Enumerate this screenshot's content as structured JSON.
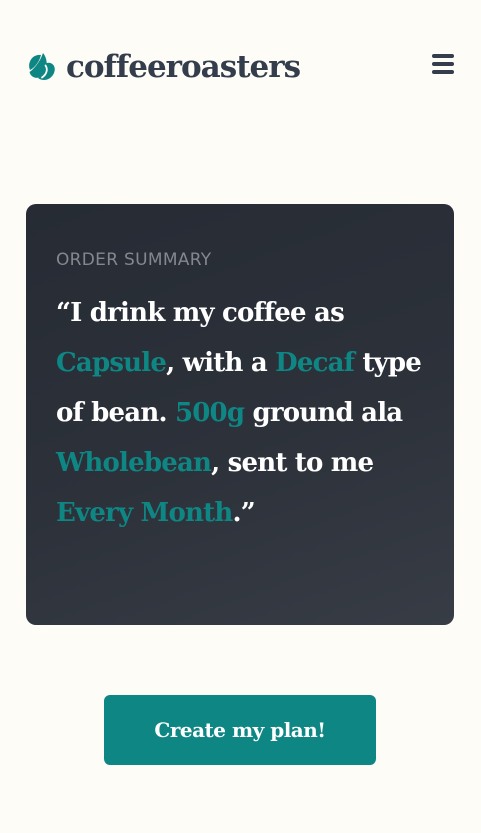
{
  "header": {
    "logo_text": "coffeeroasters",
    "logo_icon": "coffee-bean-icon",
    "menu_icon": "hamburger-menu-icon"
  },
  "summary": {
    "heading": "ORDER SUMMARY",
    "open_quote": "“",
    "text_1": "I drink my coffee as ",
    "preference": "Capsule",
    "text_2": ", with a ",
    "bean_type": "Decaf",
    "text_3": " type of bean. ",
    "quantity": "500g",
    "text_4": " ground ala ",
    "grind": "Wholebean",
    "text_5": ", sent to me ",
    "delivery": "Every Month",
    "close_quote": ".”"
  },
  "cta": {
    "label": "Create my plan!"
  },
  "colors": {
    "accent": "#0e8784",
    "dark": "#333d4b",
    "background": "#fefcf7",
    "card": "#2c343e",
    "muted": "#83888f"
  }
}
